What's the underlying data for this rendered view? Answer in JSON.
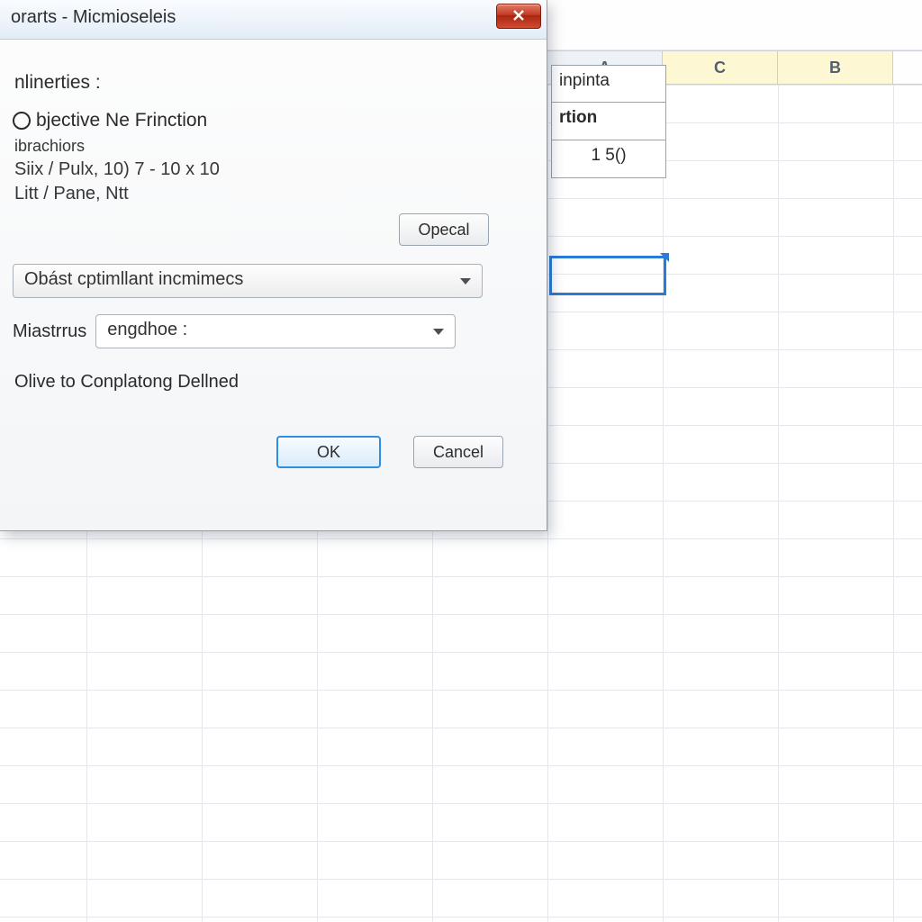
{
  "dialog": {
    "title": "orarts - Micmioseleis",
    "section_label": "nlinerties :",
    "objective": "bjective Ne Frinction",
    "sub1": "ibrachiors",
    "sub2": "Siix / Pulx,  10) 7 - 10 x 10",
    "sub3": "Litt / Pane,  Ntt",
    "opecal": "Opecal",
    "combo1": "Obást cptimllant incmimecs",
    "row2_label": "Miastrrus",
    "combo2": "engdhoe :",
    "olive": "Olive to Conplatong Dellned",
    "ok": "OK",
    "cancel": "Cancel"
  },
  "sheet": {
    "columns": [
      "A",
      "C",
      "B"
    ],
    "cells": {
      "r1": "inpinta",
      "r2": "rtion",
      "r3": "1 5()"
    }
  }
}
